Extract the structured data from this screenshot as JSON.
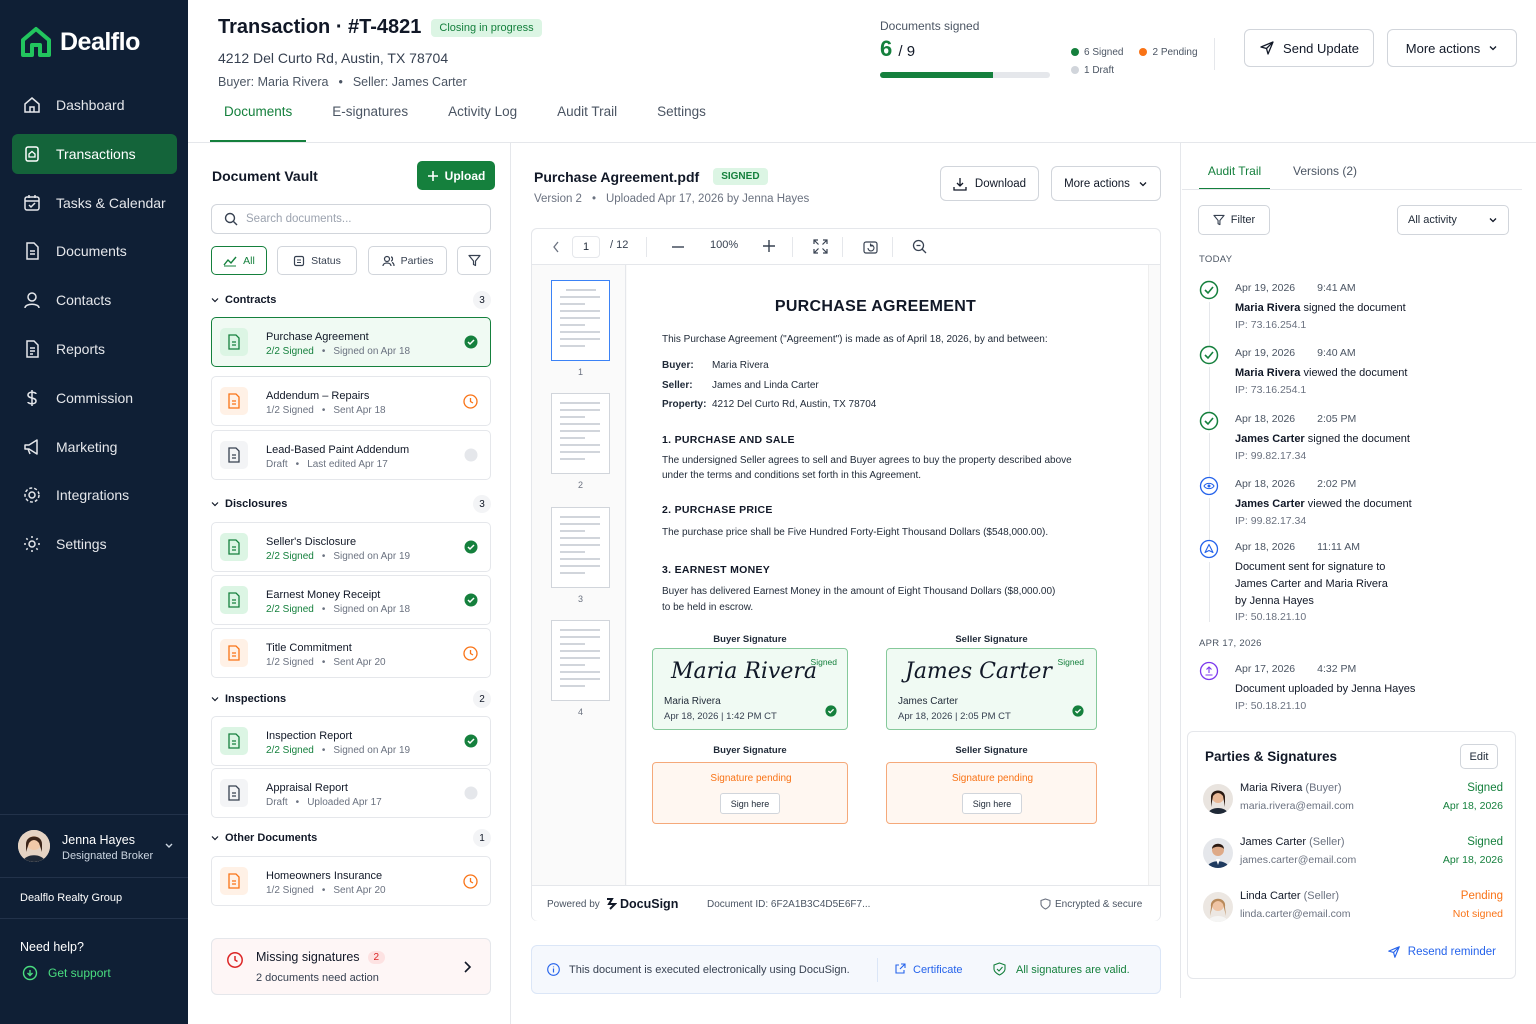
{
  "app": {
    "name": "Dealflo"
  },
  "sidebar": {
    "items": [
      {
        "label": "Dashboard"
      },
      {
        "label": "Transactions"
      },
      {
        "label": "Tasks & Calendar"
      },
      {
        "label": "Documents"
      },
      {
        "label": "Contacts"
      },
      {
        "label": "Reports"
      },
      {
        "label": "Commission"
      },
      {
        "label": "Marketing"
      },
      {
        "label": "Integrations"
      },
      {
        "label": "Settings"
      }
    ],
    "user": {
      "name": "Jenna Hayes",
      "role": "Designated Broker"
    },
    "org": "Dealflo Realty Group",
    "help": "Need help?",
    "support": "Get support"
  },
  "header": {
    "title": "Transaction · #T-4821",
    "status": "Closing in progress",
    "address": "4212 Del Curto Rd, Austin, TX 78704",
    "buyer": "Buyer: Maria Rivera",
    "separator": "•",
    "seller": "Seller: James Carter",
    "docs_label": "Documents signed",
    "docs_signed": "6",
    "docs_total": "/ 9",
    "progress": 0.667,
    "legend": {
      "signed": "6 Signed",
      "pending": "2 Pending",
      "draft": "1 Draft"
    },
    "send_update": "Send Update",
    "more_actions": "More actions"
  },
  "tabs": [
    "Documents",
    "E-signatures",
    "Activity Log",
    "Audit Trail",
    "Settings"
  ],
  "vault": {
    "title": "Document Vault",
    "upload": "Upload",
    "search_placeholder": "Search documents...",
    "filters": {
      "all": "All",
      "status": "Status",
      "parties": "Parties"
    },
    "groups": [
      {
        "name": "Contracts",
        "count": "3"
      },
      {
        "name": "Disclosures",
        "count": "3"
      },
      {
        "name": "Inspections",
        "count": "2"
      },
      {
        "name": "Other Documents",
        "count": "1"
      }
    ],
    "docs": [
      {
        "name": "Purchase Agreement",
        "status": "2/2 Signed",
        "meta": "Signed on Apr 18"
      },
      {
        "name": "Addendum – Repairs",
        "status": "1/2 Signed",
        "meta": "Sent Apr 18"
      },
      {
        "name": "Lead-Based Paint Addendum",
        "status": "Draft",
        "meta": "Last edited Apr 17"
      },
      {
        "name": "Seller's Disclosure",
        "status": "2/2 Signed",
        "meta": "Signed on Apr 19"
      },
      {
        "name": "Earnest Money Receipt",
        "status": "2/2 Signed",
        "meta": "Signed on Apr 18"
      },
      {
        "name": "Title Commitment",
        "status": "1/2 Signed",
        "meta": "Sent Apr 20"
      },
      {
        "name": "Inspection Report",
        "status": "2/2 Signed",
        "meta": "Signed on Apr 19"
      },
      {
        "name": "Appraisal Report",
        "status": "Draft",
        "meta": "Uploaded Apr 17"
      },
      {
        "name": "Homeowners Insurance",
        "status": "1/2 Signed",
        "meta": "Sent Apr 20"
      }
    ],
    "missing": {
      "title": "Missing signatures",
      "count": "2",
      "sub": "2 documents need action"
    }
  },
  "viewer": {
    "filename": "Purchase Agreement.pdf",
    "tag": "SIGNED",
    "version": "Version 2",
    "uploaded": "Uploaded Apr 17, 2026 by Jenna Hayes",
    "download": "Download",
    "more_actions": "More actions",
    "page": "1",
    "pages": "/ 12",
    "zoom": "100%",
    "thumbs": [
      "1",
      "2",
      "3",
      "4"
    ],
    "doc": {
      "title": "PURCHASE AGREEMENT",
      "intro": "This Purchase Agreement (\"Agreement\") is made as of April 18, 2026, by and between:",
      "buyer_label": "Buyer:",
      "buyer": "Maria Rivera",
      "seller_label": "Seller:",
      "seller": "James and Linda Carter",
      "property_label": "Property:",
      "property": "4212 Del Curto Rd, Austin, TX 78704",
      "s1": "1. PURCHASE AND SALE",
      "s1a": "The undersigned Seller agrees to sell and Buyer agrees to buy the property described above",
      "s1b": "under the terms and conditions set forth in this Agreement.",
      "s2": "2. PURCHASE PRICE",
      "s2a": "The purchase price shall be Five Hundred Forty-Eight Thousand Dollars ($548,000.00).",
      "s3": "3. EARNEST MONEY",
      "s3a": "Buyer has delivered Earnest Money in the amount of Eight Thousand Dollars ($8,000.00)",
      "s3b": "to be held in escrow.",
      "sig_buyer_label": "Buyer Signature",
      "sig_seller_label": "Seller Signature",
      "signed": "Signed",
      "sig1_script": "Maria Rivera",
      "sig1_name": "Maria Rivera",
      "sig1_date": "Apr 18, 2026 | 1:42 PM CT",
      "sig2_script": "James Carter",
      "sig2_name": "James Carter",
      "sig2_date": "Apr 18, 2026 | 2:05 PM CT",
      "pending": "Signature pending",
      "sign_here": "Sign here"
    },
    "footer": {
      "powered": "Powered by",
      "brand": "DocuSign",
      "docid": "Document ID: 6F2A1B3C4D5E6F7...",
      "secure": "Encrypted & secure"
    },
    "info": {
      "text": "This document is executed electronically using DocuSign.",
      "certificate": "Certificate",
      "valid": "All signatures are valid."
    }
  },
  "audit": {
    "tabs": [
      "Audit Trail",
      "Versions (2)"
    ],
    "filter": "Filter",
    "activity": "All activity",
    "today": "TODAY",
    "apr17": "APR 17, 2026",
    "events": [
      {
        "date": "Apr 19, 2026",
        "time": "9:41 AM",
        "who": "Maria Rivera",
        "what": " signed the document",
        "ip": "IP: 73.16.254.1"
      },
      {
        "date": "Apr 19, 2026",
        "time": "9:40 AM",
        "who": "Maria Rivera",
        "what": " viewed the document",
        "ip": "IP: 73.16.254.1"
      },
      {
        "date": "Apr 18, 2026",
        "time": "2:05 PM",
        "who": "James Carter",
        "what": " signed the document",
        "ip": "IP: 99.82.17.34"
      },
      {
        "date": "Apr 18, 2026",
        "time": "2:02 PM",
        "who": "James Carter",
        "what": " viewed the document",
        "ip": "IP: 99.82.17.34"
      },
      {
        "date": "Apr 18, 2026",
        "time": "11:11 AM",
        "l1": "Document sent for signature to",
        "l2": "James Carter and Maria Rivera",
        "l3": "by Jenna Hayes",
        "ip": "IP: 50.18.21.10"
      },
      {
        "date": "Apr 17, 2026",
        "time": "4:32 PM",
        "l1": "Document uploaded by Jenna Hayes",
        "ip": "IP: 50.18.21.10"
      }
    ]
  },
  "parties": {
    "title": "Parties & Signatures",
    "edit": "Edit",
    "list": [
      {
        "name": "Maria Rivera",
        "role": " (Buyer)",
        "email": "maria.rivera@email.com",
        "status": "Signed",
        "date": "Apr 18, 2026"
      },
      {
        "name": "James Carter",
        "role": " (Seller)",
        "email": "james.carter@email.com",
        "status": "Signed",
        "date": "Apr 18, 2026"
      },
      {
        "name": "Linda Carter",
        "role": " (Seller)",
        "email": "linda.carter@email.com",
        "status": "Pending",
        "date": "Not signed"
      }
    ],
    "resend": "Resend reminder"
  },
  "colors": {
    "brand": "#15803d",
    "sidebar": "#0f1f35",
    "pending": "#f97316",
    "info": "#2563eb"
  }
}
